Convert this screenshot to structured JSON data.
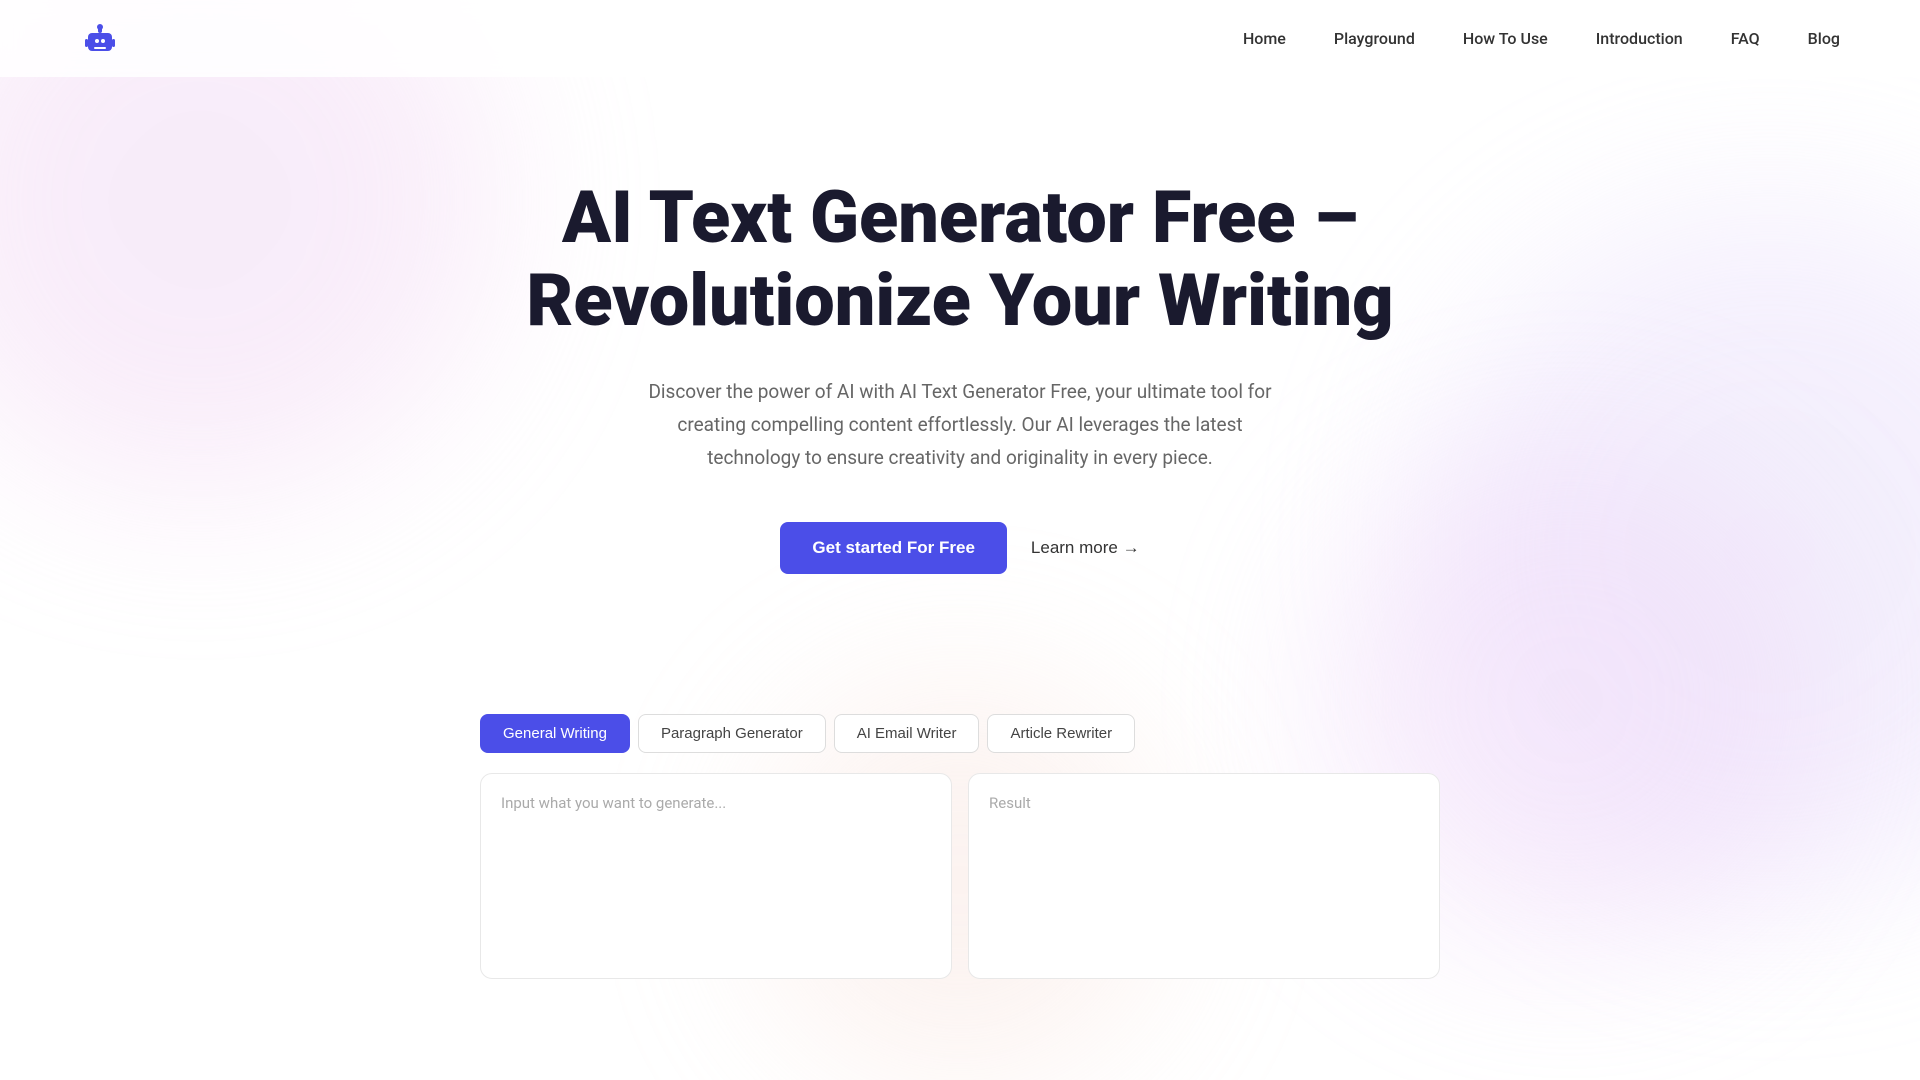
{
  "logo": {
    "text": ""
  },
  "nav": {
    "items": [
      {
        "label": "Home",
        "id": "home"
      },
      {
        "label": "Playground",
        "id": "playground"
      },
      {
        "label": "How To Use",
        "id": "how-to-use"
      },
      {
        "label": "Introduction",
        "id": "introduction"
      },
      {
        "label": "FAQ",
        "id": "faq"
      },
      {
        "label": "Blog",
        "id": "blog"
      }
    ]
  },
  "hero": {
    "title": "AI Text Generator Free – Revolutionize Your Writing",
    "subtitle": "Discover the power of AI with AI Text Generator Free, your ultimate tool for creating compelling content effortlessly. Our AI leverages the latest technology to ensure creativity and originality in every piece.",
    "cta_primary": "Get started For Free",
    "cta_secondary": "Learn more →"
  },
  "tool": {
    "tabs": [
      {
        "label": "General Writing",
        "id": "general",
        "active": true
      },
      {
        "label": "Paragraph Generator",
        "id": "paragraph",
        "active": false
      },
      {
        "label": "AI Email Writer",
        "id": "email",
        "active": false
      },
      {
        "label": "Article Rewriter",
        "id": "article",
        "active": false
      }
    ],
    "input_placeholder": "Input what you want to generate...",
    "result_placeholder": "Result"
  }
}
